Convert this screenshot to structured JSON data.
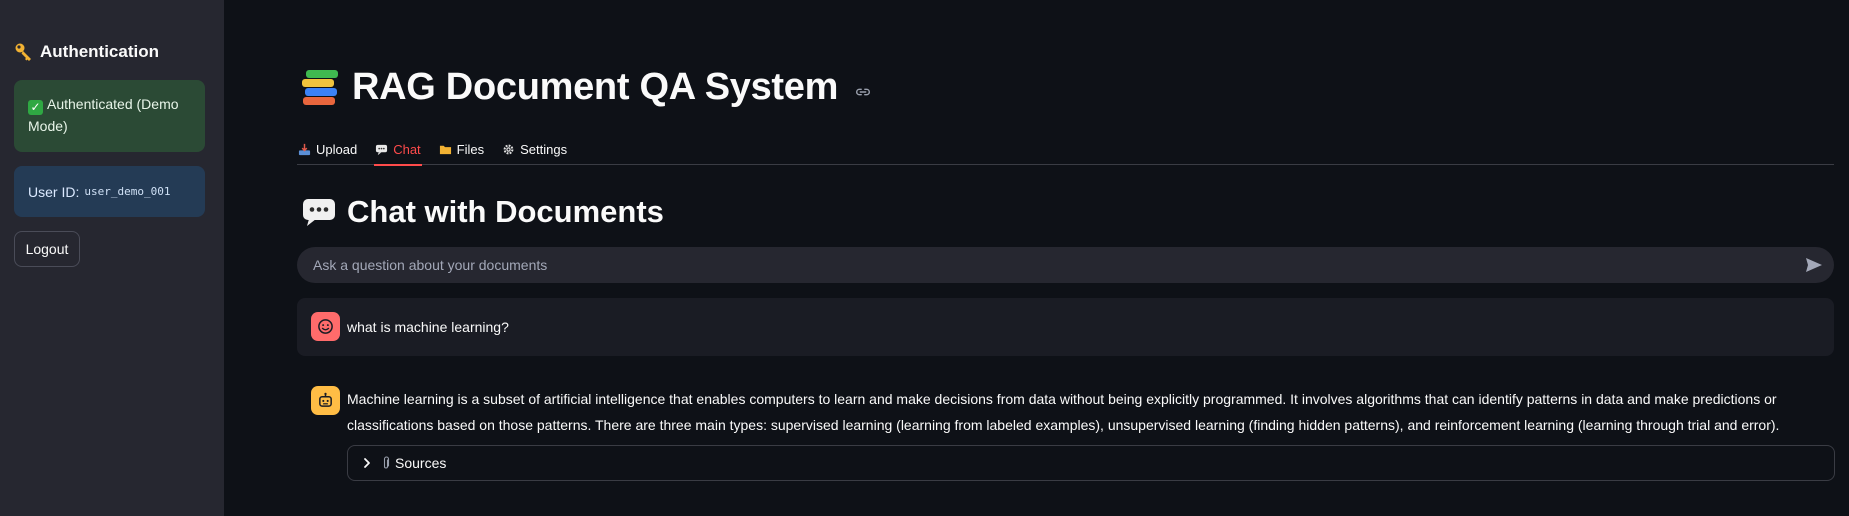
{
  "sidebar": {
    "heading": "Authentication",
    "auth_status": "Authenticated (Demo Mode)",
    "user_id_label": "User ID:",
    "user_id_value": "user_demo_001",
    "logout_label": "Logout"
  },
  "main": {
    "title": "RAG Document QA System",
    "tabs": [
      {
        "label": "Upload",
        "icon": "inbox-tray-icon"
      },
      {
        "label": "Chat",
        "icon": "speech-balloon-icon",
        "active": true
      },
      {
        "label": "Files",
        "icon": "folder-icon"
      },
      {
        "label": "Settings",
        "icon": "gear-icon"
      }
    ],
    "section_title": "Chat with Documents",
    "chat_input_placeholder": "Ask a question about your documents"
  },
  "messages": [
    {
      "role": "user",
      "text": "what is machine learning?"
    },
    {
      "role": "assistant",
      "text": "Machine learning is a subset of artificial intelligence that enables computers to learn and make decisions from data without being explicitly programmed. It involves algorithms that can identify patterns in data and make predictions or classifications based on those patterns. There are three main types: supervised learning (learning from labeled examples), unsupervised learning (finding hidden patterns), and reinforcement learning (learning through trial and error)."
    }
  ],
  "sources_label": "Sources",
  "colors": {
    "accent": "#ff4b4b",
    "background": "#0e1117",
    "sidebar": "#262730",
    "success_bg": "#2b4a35",
    "info_bg": "#243b55",
    "user_avatar": "#ff6b6b",
    "assistant_avatar": "#ffbd45"
  }
}
